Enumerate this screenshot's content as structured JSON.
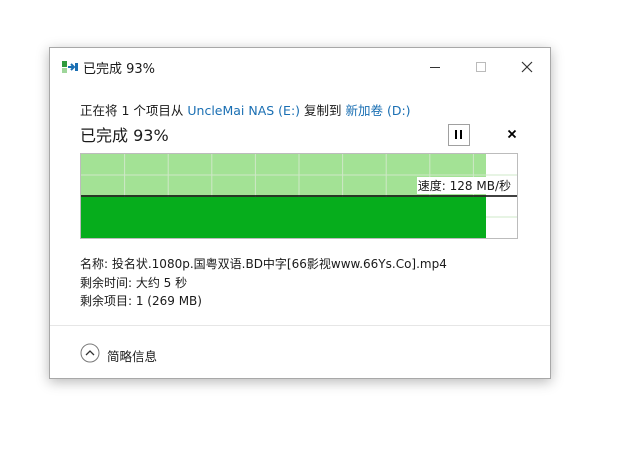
{
  "window": {
    "title": "已完成 93%",
    "icons": {
      "app": "file-copy-icon",
      "minimize": "minimize-icon",
      "maximize": "maximize-icon",
      "close": "close-icon"
    }
  },
  "copy_info": {
    "prefix": "正在将 1 个项目从 ",
    "source": "UncleMai NAS (E:)",
    "middle": " 复制到 ",
    "destination": "新加卷 (D:)"
  },
  "progress": {
    "heading": "已完成 93%",
    "percent": 93
  },
  "controls": {
    "pause_icon": "pause-icon",
    "cancel_icon": "close-icon"
  },
  "speed": {
    "label": "速度: 128 MB/秒"
  },
  "details": {
    "name": "名称: 投名状.1080p.国粤双语.BD中字[66影视www.66Ys.Co].mp4",
    "time_remaining": "剩余时间: 大约 5 秒",
    "items_remaining": "剩余项目: 1 (269 MB)"
  },
  "footer": {
    "toggle_label": "简略信息",
    "toggle_icon": "chevron-up-icon"
  },
  "colors": {
    "progress_fill": "#a3e295",
    "throughput_fill": "#06ad1c",
    "speed_line": "#000000",
    "grid": "#cfe8c8",
    "chart_border": "#bcbcbc",
    "link": "#1a6fb3"
  }
}
